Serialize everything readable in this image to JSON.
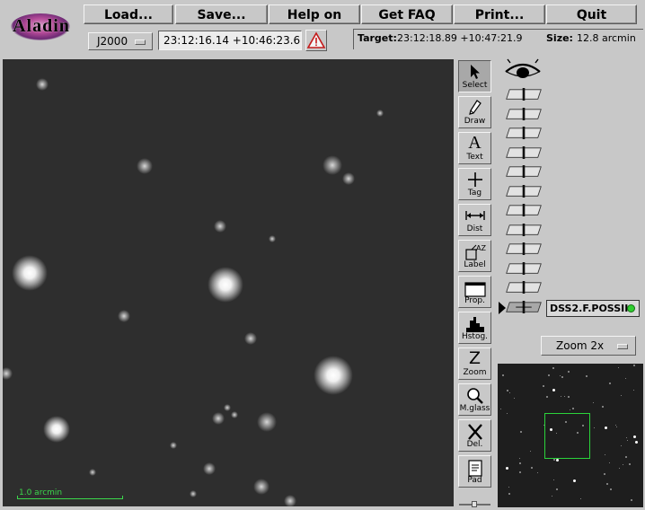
{
  "app": {
    "name": "Aladin"
  },
  "menu": {
    "load": "Load...",
    "save": "Save...",
    "help": "Help on",
    "faq": "Get FAQ",
    "print": "Print...",
    "quit": "Quit"
  },
  "location": {
    "equinox": "J2000",
    "coordinates": "23:12:16.14 +10:46:23.6"
  },
  "target": {
    "label": "Target:",
    "value": "23:12:18.89 +10:47:21.9",
    "size_label": "Size:",
    "size_value": "12.8 arcmin"
  },
  "tools": [
    {
      "label": "Select",
      "icon": "arrow-cursor-icon"
    },
    {
      "label": "Draw",
      "icon": "pencil-icon"
    },
    {
      "label": "Text",
      "icon": "text-A-icon"
    },
    {
      "label": "Tag",
      "icon": "crosshair-icon"
    },
    {
      "label": "Dist",
      "icon": "distance-arrow-icon"
    },
    {
      "label": "Label",
      "icon": "label-az-icon"
    },
    {
      "label": "Prop.",
      "icon": "properties-window-icon"
    },
    {
      "label": "Hstog.",
      "icon": "histogram-icon"
    },
    {
      "label": "Zoom",
      "icon": "zoom-z-icon"
    },
    {
      "label": "M.glass",
      "icon": "magnifying-glass-icon"
    },
    {
      "label": "Del.",
      "icon": "delete-x-icon"
    },
    {
      "label": "Pad",
      "icon": "notepad-icon"
    }
  ],
  "active_tool": "Select",
  "layers": {
    "active_plane": "DSS2.F.POSSII",
    "status_color": "#2fce2f"
  },
  "view": {
    "scale_label": "1.0 arcmin",
    "zoom": "Zoom 2x",
    "overlay_color": "#3bd84b"
  }
}
